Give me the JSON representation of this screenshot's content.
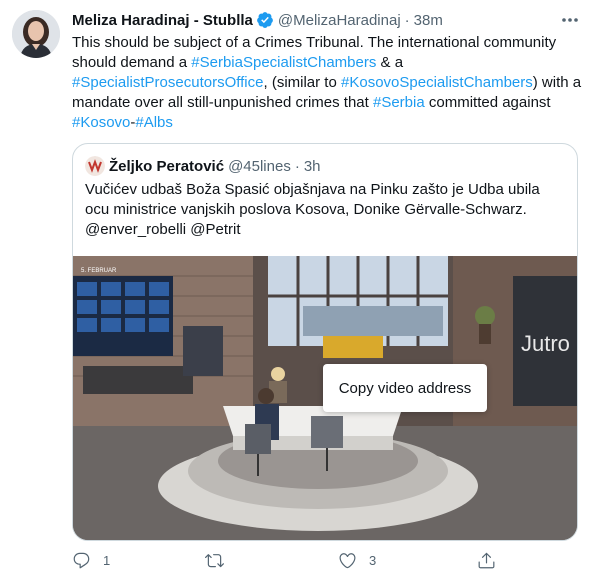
{
  "tweet": {
    "author_name": "Meliza Haradinaj - Stublla",
    "handle": "@MelizaHaradinaj",
    "separator": "·",
    "time": "38m",
    "text_parts": [
      {
        "text": "This should be subject of a Crimes Tribunal. The international community should demand a ",
        "tag": false
      },
      {
        "text": "#SerbiaSpecialistChambers",
        "tag": true
      },
      {
        "text": " & a ",
        "tag": false
      },
      {
        "text": "#SpecialistProsecutorsOffice",
        "tag": true
      },
      {
        "text": ", (similar to ",
        "tag": false
      },
      {
        "text": "#KosovoSpecialistChambers",
        "tag": true
      },
      {
        "text": ") with a mandate over all still-unpunished crimes that ",
        "tag": false
      },
      {
        "text": "#Serbia",
        "tag": true
      },
      {
        "text": " committed against ",
        "tag": false
      },
      {
        "text": "#Kosovo",
        "tag": true
      },
      {
        "text": "-",
        "tag": false
      },
      {
        "text": "#Albs",
        "tag": true
      }
    ]
  },
  "quoted": {
    "author_name": "Željko Peratović",
    "handle": "@45lines",
    "separator": "·",
    "time": "3h",
    "text": "Vučićev udbaš Boža Spasić objašnjava na Pinku zašto je Udba ubila ocu ministrice vanjskih poslova Kosova, Donike Gërvalle-Schwarz. @enver_robelli @Petrit",
    "video": {
      "context_menu_item": "Copy video address",
      "screen_text_left": "5. FEBRUAR",
      "screen_text_right": "Jutro"
    }
  },
  "actions": {
    "reply_count": "1",
    "retweet_count": "",
    "like_count": "3"
  },
  "colors": {
    "accent": "#1d9bf0",
    "text": "#0f1419",
    "muted": "#536471",
    "border": "#cfd9de"
  },
  "icons": [
    "verified-badge-icon",
    "more-icon",
    "reply-icon",
    "retweet-icon",
    "like-icon",
    "share-icon"
  ]
}
